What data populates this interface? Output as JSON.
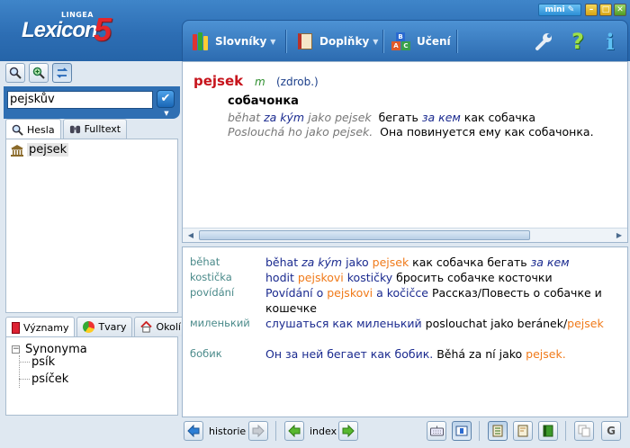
{
  "app": {
    "brand_small": "LINGEA",
    "brand_word": "Lexicon",
    "brand_number": "5",
    "mini_label": "mini"
  },
  "menu": [
    {
      "label": "Slovníky",
      "has_dropdown": true,
      "icon": "books-icon"
    },
    {
      "label": "Doplňky",
      "has_dropdown": true,
      "icon": "notebook-icon"
    },
    {
      "label": "Učení",
      "has_dropdown": false,
      "icon": "abc-blocks-icon"
    }
  ],
  "toolbar_icons": [
    "wrench-icon",
    "help-icon",
    "info-icon"
  ],
  "search": {
    "value": "pejskův"
  },
  "left_tabs": [
    {
      "label": "Hesla",
      "icon": "magnifier-icon",
      "active": true
    },
    {
      "label": "Fulltext",
      "icon": "binoculars-icon",
      "active": false
    }
  ],
  "headword_list": [
    {
      "label": "pejsek",
      "icon": "bank-icon"
    }
  ],
  "lower_tabs": [
    {
      "label": "Významy",
      "icon": "meanings-icon",
      "active": true
    },
    {
      "label": "Tvary",
      "icon": "shapes-icon",
      "active": false
    },
    {
      "label": "Okolí",
      "icon": "house-icon",
      "active": false
    }
  ],
  "synonyms": {
    "root": "Synonyma",
    "items": [
      "psík",
      "psíček"
    ]
  },
  "entry": {
    "headword": "pejsek",
    "gram": "m",
    "note": "(zdrob.)",
    "translation": "собачонка",
    "examples": [
      {
        "cz1": "běhat",
        "cz2": "za kým",
        "cz3": "jako pejsek",
        "ru1": "бегать",
        "ru2": "за кем",
        "ru3": "как собачка"
      },
      {
        "cz1": "Poslouchá ho jako pejsek.",
        "cz2": "",
        "cz3": "",
        "ru1": "Она повинуется ему как собачонка.",
        "ru2": "",
        "ru3": ""
      }
    ]
  },
  "related": [
    {
      "key": "běhat",
      "parts": [
        {
          "t": "běhat ",
          "c": "blue"
        },
        {
          "t": "za kým",
          "c": "bluei"
        },
        {
          "t": " jako ",
          "c": "blue"
        },
        {
          "t": "pejsek",
          "c": "orange"
        },
        {
          "t": "  как собачка бегать ",
          "c": "black"
        },
        {
          "t": "за кем",
          "c": "bluei"
        }
      ]
    },
    {
      "key": "kostička",
      "parts": [
        {
          "t": "hodit ",
          "c": "blue"
        },
        {
          "t": "pejskovi",
          "c": "orange"
        },
        {
          "t": " kostičky",
          "c": "blue"
        },
        {
          "t": "  бросить собачке косточки",
          "c": "black"
        }
      ]
    },
    {
      "key": "povídání",
      "parts": [
        {
          "t": "Povídání o ",
          "c": "blue"
        },
        {
          "t": "pejskovi",
          "c": "orange"
        },
        {
          "t": " a kočičce",
          "c": "blue"
        },
        {
          "t": "  Рассказ/Повесть о собачке и кошечке",
          "c": "black"
        }
      ]
    },
    {
      "key": "миленький",
      "parts": [
        {
          "t": "слушаться как миленький",
          "c": "blue"
        },
        {
          "t": "  poslouchat jako beránek/",
          "c": "black"
        },
        {
          "t": "pejsek",
          "c": "orange"
        }
      ]
    },
    {
      "key": "бобик",
      "parts": [
        {
          "t": "Он за ней бегает как бобик.",
          "c": "blue"
        },
        {
          "t": "  Běhá za ní jako ",
          "c": "black"
        },
        {
          "t": "pejsek.",
          "c": "orange"
        }
      ]
    }
  ],
  "bottom": {
    "history_label": "historie",
    "index_label": "index",
    "btn_g": "G"
  },
  "colors": {
    "brand_blue": "#2d6eb4",
    "headword_red": "#c7141c",
    "link_blue": "#1a2a8f",
    "highlight_orange": "#f07a1a"
  }
}
